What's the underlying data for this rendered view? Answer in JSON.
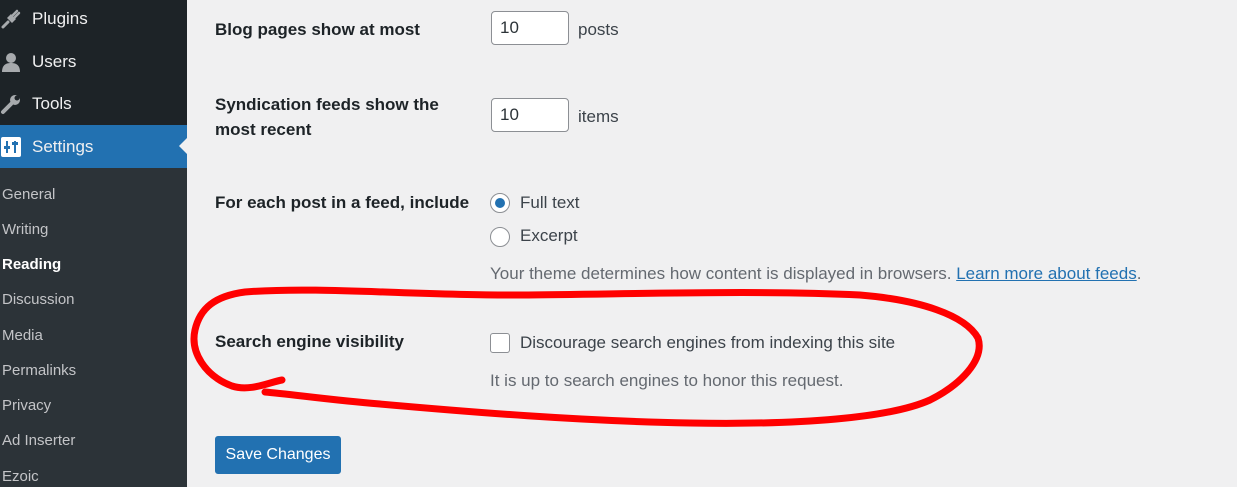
{
  "sidebar": {
    "menu": [
      {
        "label": "Plugins",
        "icon": "plugin-icon"
      },
      {
        "label": "Users",
        "icon": "users-icon"
      },
      {
        "label": "Tools",
        "icon": "wrench-icon"
      },
      {
        "label": "Settings",
        "icon": "settings-sliders-icon",
        "current": true
      }
    ],
    "submenu": [
      "General",
      "Writing",
      "Reading",
      "Discussion",
      "Media",
      "Permalinks",
      "Privacy",
      "Ad Inserter",
      "Ezoic"
    ],
    "current_submenu": "Reading"
  },
  "form": {
    "blog_pages": {
      "label": "Blog pages show at most",
      "value": "10",
      "suffix": "posts"
    },
    "feeds": {
      "label": "Syndication feeds show the most recent",
      "value": "10",
      "suffix": "items"
    },
    "feed_content": {
      "label": "For each post in a feed, include",
      "options": [
        "Full text",
        "Excerpt"
      ],
      "selected": "Full text",
      "description": "Your theme determines how content is displayed in browsers.",
      "link_text": "Learn more about feeds",
      "period": "."
    },
    "search_visibility": {
      "label": "Search engine visibility",
      "checkbox_label": "Discourage search engines from indexing this site",
      "checked": false,
      "description": "It is up to search engines to honor this request."
    },
    "save_label": "Save Changes"
  },
  "colors": {
    "sidebar_bg": "#1d2327",
    "submenu_bg": "#2c3338",
    "accent": "#2271b1",
    "annotation": "#ff0000"
  }
}
